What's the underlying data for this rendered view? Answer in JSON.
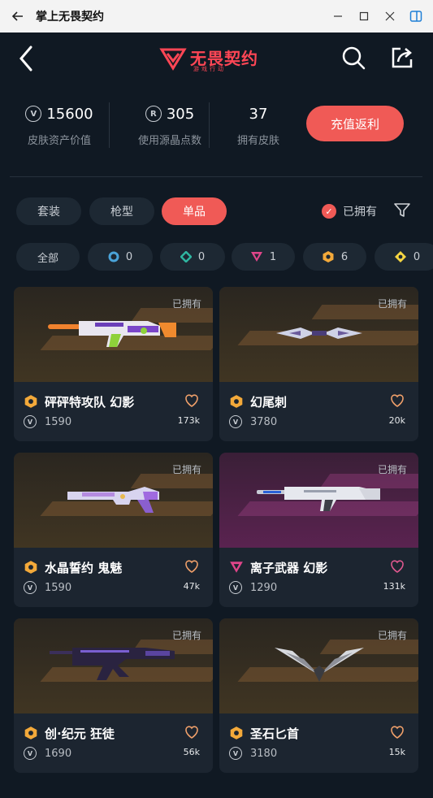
{
  "window": {
    "title": "掌上无畏契约"
  },
  "app": {
    "logo_text": "无畏契约",
    "logo_sub": "游戏行动"
  },
  "stats": {
    "assets_value": "15600",
    "assets_label": "皮肤资产价值",
    "points_value": "305",
    "points_label": "使用源晶点数",
    "skins_value": "37",
    "skins_label": "拥有皮肤",
    "recharge_label": "充值返利"
  },
  "tabs": [
    {
      "label": "套装",
      "active": false
    },
    {
      "label": "枪型",
      "active": false
    },
    {
      "label": "单品",
      "active": true
    }
  ],
  "owned_filter": {
    "label": "已拥有",
    "checked": true
  },
  "tiers": [
    {
      "label": "全部"
    },
    {
      "count": "0",
      "icon": "select-tier-icon",
      "color": "#4aa3d8"
    },
    {
      "count": "0",
      "icon": "deluxe-tier-icon",
      "color": "#2fb5a0"
    },
    {
      "count": "1",
      "icon": "premium-tier-icon",
      "color": "#e0458a"
    },
    {
      "count": "6",
      "icon": "exclusive-tier-icon",
      "color": "#f3a93a"
    },
    {
      "count": "0",
      "icon": "ultra-tier-icon",
      "color": "#f5d542"
    }
  ],
  "skins": [
    {
      "owned": "已拥有",
      "name": "砰砰特攻队 幻影",
      "price": "1590",
      "likes": "173k",
      "tier": "exclusive",
      "tier_color": "#f3a93a",
      "bg": "brown",
      "heart_color": "#f0a06a"
    },
    {
      "owned": "已拥有",
      "name": "幻尾刺",
      "price": "3780",
      "likes": "20k",
      "tier": "exclusive",
      "tier_color": "#f3a93a",
      "bg": "brown",
      "heart_color": "#f0a06a"
    },
    {
      "owned": "已拥有",
      "name": "水晶誓约 鬼魅",
      "price": "1590",
      "likes": "47k",
      "tier": "exclusive",
      "tier_color": "#f3a93a",
      "bg": "brown",
      "heart_color": "#f0a06a"
    },
    {
      "owned": "已拥有",
      "name": "离子武器 幻影",
      "price": "1290",
      "likes": "131k",
      "tier": "premium",
      "tier_color": "#e0458a",
      "bg": "purple",
      "heart_color": "#e0588f"
    },
    {
      "owned": "已拥有",
      "name": "创·纪元 狂徒",
      "price": "1690",
      "likes": "56k",
      "tier": "exclusive",
      "tier_color": "#f3a93a",
      "bg": "brown",
      "heart_color": "#f0a06a"
    },
    {
      "owned": "已拥有",
      "name": "圣石匕首",
      "price": "3180",
      "likes": "15k",
      "tier": "exclusive",
      "tier_color": "#f3a93a",
      "bg": "brown",
      "heart_color": "#f0a06a"
    }
  ]
}
